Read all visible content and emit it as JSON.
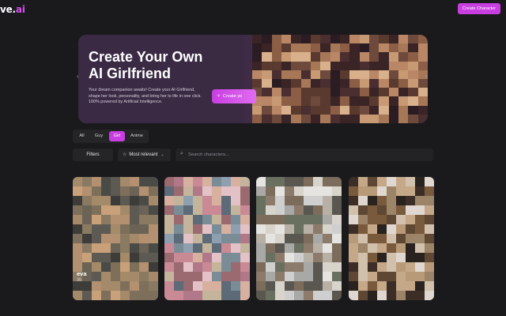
{
  "header": {
    "logo_text": "ve.",
    "logo_accent": "ai",
    "create_button": "Create Character"
  },
  "hero": {
    "title": "Create Your Own AI Girlfriend",
    "subtitle": "Your dream companion awaits! Create your AI Girlfriend, shape her look, personality, and bring her to life in one click. 100% powered by Artificial Intelligence.",
    "cta": "Create yo",
    "prev_icon": "chevron-left-icon",
    "next_icon": "chevron-right-icon"
  },
  "tabs": [
    {
      "label": "All",
      "active": false
    },
    {
      "label": "Guy",
      "active": false
    },
    {
      "label": "Girl",
      "active": true
    },
    {
      "label": "Anime",
      "active": false
    }
  ],
  "filters": {
    "filters_label": "Filters",
    "sort_label": "Most relevant",
    "search_placeholder": "Search characters..."
  },
  "cards": [
    {
      "name": "eva",
      "count": "35"
    },
    {
      "name": "",
      "count": ""
    },
    {
      "name": "",
      "count": ""
    },
    {
      "name": "",
      "count": ""
    }
  ],
  "colors": {
    "accent": "#c93ee0",
    "background": "#1a1a1d",
    "panel": "#252528"
  }
}
